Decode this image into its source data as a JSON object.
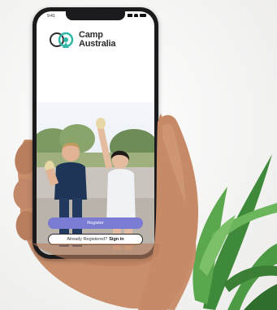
{
  "status_bar": {
    "time": "9:41"
  },
  "logo": {
    "line1": "Camp",
    "line2": "Australia",
    "icon": "camp-australia-logo-icon"
  },
  "buttons": {
    "register_label": "Register",
    "signin_prefix": "Already Registered?",
    "signin_link": "Sign in"
  },
  "colors": {
    "accent": "#7a7bd3",
    "logo_teal": "#2fb8a8",
    "logo_dark": "#2b2b2b"
  },
  "icons": [
    "signal-icon",
    "wifi-icon",
    "battery-icon"
  ]
}
